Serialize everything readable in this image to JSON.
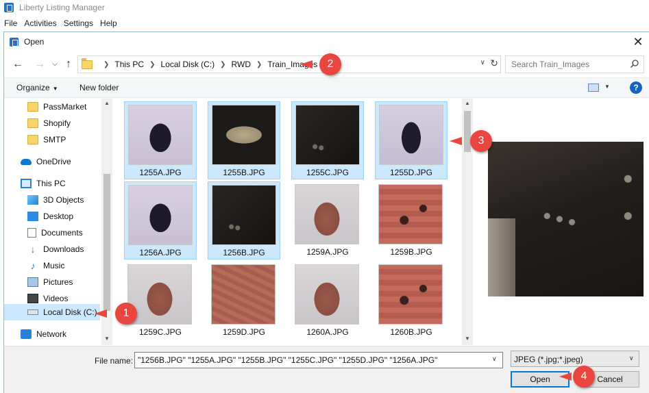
{
  "app": {
    "title": "Liberty Listing Manager",
    "menu": [
      "File",
      "Activities",
      "Settings",
      "Help"
    ]
  },
  "dialog": {
    "title": "Open",
    "close_glyph": "✕"
  },
  "address": {
    "crumbs": [
      "This PC",
      "Local Disk (C:)",
      "RWD",
      "Train_Images"
    ],
    "search_placeholder": "Search Train_Images"
  },
  "toolbar": {
    "organize": "Organize",
    "new_folder": "New folder",
    "help": "?"
  },
  "nav": {
    "items": [
      {
        "label": "PassMarket",
        "icon": "folder-icon"
      },
      {
        "label": "Shopify",
        "icon": "folder-icon"
      },
      {
        "label": "SMTP",
        "icon": "folder-icon"
      },
      {
        "label": "OneDrive",
        "icon": "cloud-icon"
      },
      {
        "label": "This PC",
        "icon": "pc-icon"
      },
      {
        "label": "3D Objects",
        "icon": "3d-objects-icon"
      },
      {
        "label": "Desktop",
        "icon": "desktop-icon"
      },
      {
        "label": "Documents",
        "icon": "documents-icon"
      },
      {
        "label": "Downloads",
        "icon": "downloads-icon"
      },
      {
        "label": "Music",
        "icon": "music-icon"
      },
      {
        "label": "Pictures",
        "icon": "pictures-icon"
      },
      {
        "label": "Videos",
        "icon": "videos-icon"
      },
      {
        "label": "Local Disk (C:)",
        "icon": "disk-icon",
        "selected": true
      },
      {
        "label": "Network",
        "icon": "network-icon"
      }
    ]
  },
  "files": [
    {
      "name": "1255A.JPG",
      "selected": true
    },
    {
      "name": "1255B.JPG",
      "selected": true
    },
    {
      "name": "1255C.JPG",
      "selected": true
    },
    {
      "name": "1255D.JPG",
      "selected": true
    },
    {
      "name": "1256A.JPG",
      "selected": true
    },
    {
      "name": "1256B.JPG",
      "selected": true
    },
    {
      "name": "1259A.JPG",
      "selected": false
    },
    {
      "name": "1259B.JPG",
      "selected": false
    },
    {
      "name": "1259C.JPG",
      "selected": false
    },
    {
      "name": "1259D.JPG",
      "selected": false
    },
    {
      "name": "1260A.JPG",
      "selected": false
    },
    {
      "name": "1260B.JPG",
      "selected": false
    }
  ],
  "bottom": {
    "file_name_label": "File name:",
    "file_name_value": "\"1256B.JPG\" \"1255A.JPG\" \"1255B.JPG\" \"1255C.JPG\" \"1255D.JPG\" \"1256A.JPG\"",
    "file_type": "JPEG (*.jpg;*.jpeg)",
    "open": "Open",
    "cancel": "Cancel"
  },
  "callouts": [
    "1",
    "2",
    "3",
    "4"
  ],
  "colors": {
    "accent": "#0078d7",
    "selection": "#cce8ff",
    "callout": "#e8463e"
  }
}
